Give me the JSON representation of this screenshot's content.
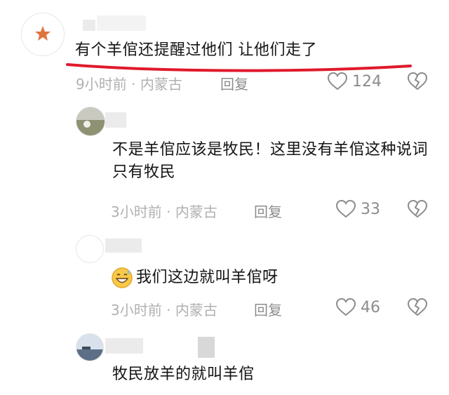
{
  "comments": [
    {
      "text": "有个羊倌还提醒过他们 让他们走了",
      "time": "9小时前",
      "location": "内蒙古",
      "reply_label": "回复",
      "likes": "124"
    },
    {
      "text": "不是羊倌应该是牧民！这里没有羊倌这种说词只有牧民",
      "time": "3小时前",
      "location": "内蒙古",
      "reply_label": "回复",
      "likes": "33"
    },
    {
      "emoji": "sweat-smile-emoji",
      "text": "我们这边就叫羊倌呀",
      "time": "3小时前",
      "location": "内蒙古",
      "reply_label": "回复",
      "likes": "46"
    },
    {
      "text": "牧民放羊的就叫羊倌"
    }
  ],
  "meta_separator": "·",
  "colors": {
    "underline": "#e0192b",
    "meta": "#b0b0b0",
    "icon": "#8c8c8c"
  }
}
